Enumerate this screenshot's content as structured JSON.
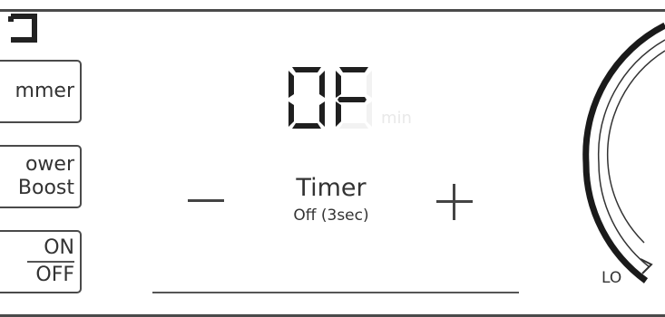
{
  "panel": {
    "buttons": {
      "simmer": "mmer",
      "power_boost": [
        "ower",
        "Boost"
      ],
      "on": "ON",
      "off": "OFF"
    },
    "display": {
      "value": "0F",
      "unit": "min"
    },
    "timer": {
      "label": "Timer",
      "status": "Off (3sec)"
    },
    "dial": {
      "low_label": "LO"
    }
  },
  "icons": [
    "corner-icon",
    "minus-icon",
    "plus-icon"
  ],
  "colors": {
    "line": "#4a4a4a",
    "text": "#333333",
    "unit_faint": "#e9e9e9"
  }
}
